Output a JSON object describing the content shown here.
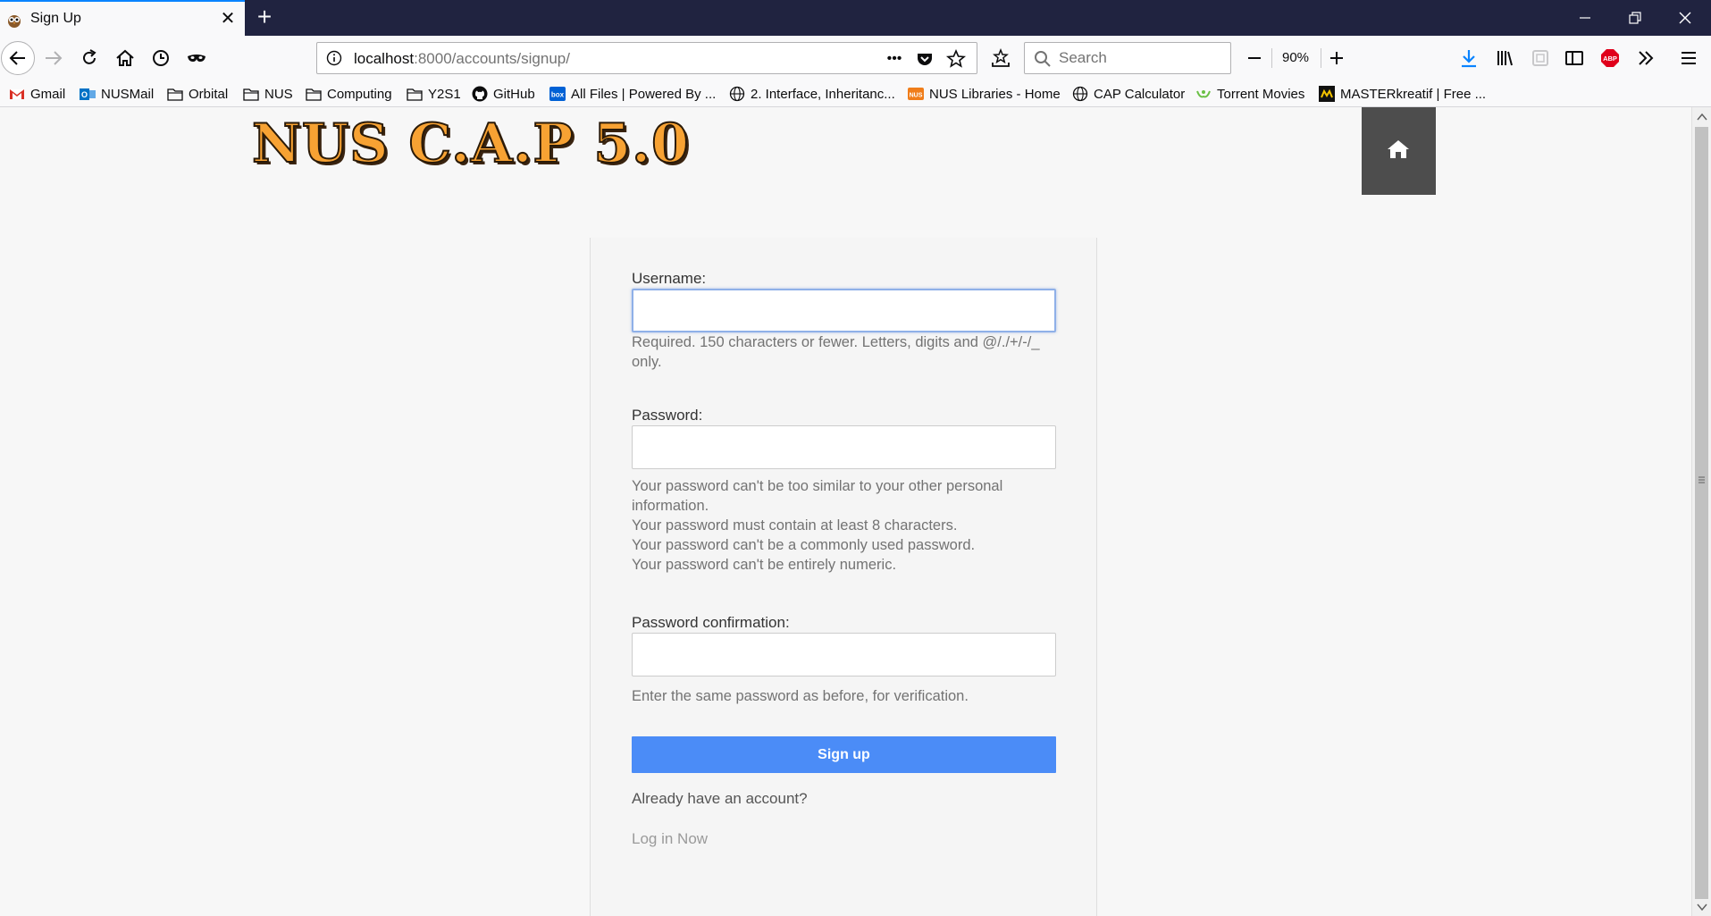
{
  "tab": {
    "title": "Sign Up",
    "close_glyph": "✕",
    "new_tab_glyph": "+"
  },
  "window_controls": [
    "minimize-icon",
    "restore-icon",
    "close-icon"
  ],
  "navbar": {
    "url_host": "localhost",
    "url_rest": ":8000/accounts/signup/",
    "search_placeholder": "Search",
    "zoom": "90%",
    "more_glyph": "•••"
  },
  "bookmarks": [
    {
      "label": "Gmail",
      "icon": "gmail-icon"
    },
    {
      "label": "NUSMail",
      "icon": "outlook-icon"
    },
    {
      "label": "Orbital",
      "icon": "folder-icon"
    },
    {
      "label": "NUS",
      "icon": "folder-icon"
    },
    {
      "label": "Computing",
      "icon": "folder-icon"
    },
    {
      "label": "Y2S1",
      "icon": "folder-icon"
    },
    {
      "label": "GitHub",
      "icon": "github-icon"
    },
    {
      "label": "All Files | Powered By ...",
      "icon": "box-icon"
    },
    {
      "label": "2. Interface, Inheritanc...",
      "icon": "globe-icon"
    },
    {
      "label": "NUS Libraries - Home",
      "icon": "nus-icon"
    },
    {
      "label": "CAP Calculator",
      "icon": "globe-icon"
    },
    {
      "label": "Torrent Movies",
      "icon": "yts-icon"
    },
    {
      "label": "MASTERkreatif | Free ...",
      "icon": "masterkreatif-icon"
    }
  ],
  "page": {
    "logo": "NUS C.A.P 5.0",
    "form": {
      "username_label": "Username:",
      "username_value": "",
      "username_help": "Required. 150 characters or fewer. Letters, digits and @/./+/-/_ only.",
      "password_label": "Password:",
      "password_help": [
        "Your password can't be too similar to your other personal information.",
        "Your password must contain at least 8 characters.",
        "Your password can't be a commonly used password.",
        "Your password can't be entirely numeric."
      ],
      "confirm_label": "Password confirmation:",
      "confirm_help": "Enter the same password as before, for verification.",
      "submit": "Sign up",
      "already": "Already have an account?",
      "login_link": "Log in Now"
    }
  },
  "colors": {
    "tabstrip": "#202340",
    "button": "#4b8cf7",
    "home_button": "#4d4d4d",
    "logo": "#f7a233"
  }
}
